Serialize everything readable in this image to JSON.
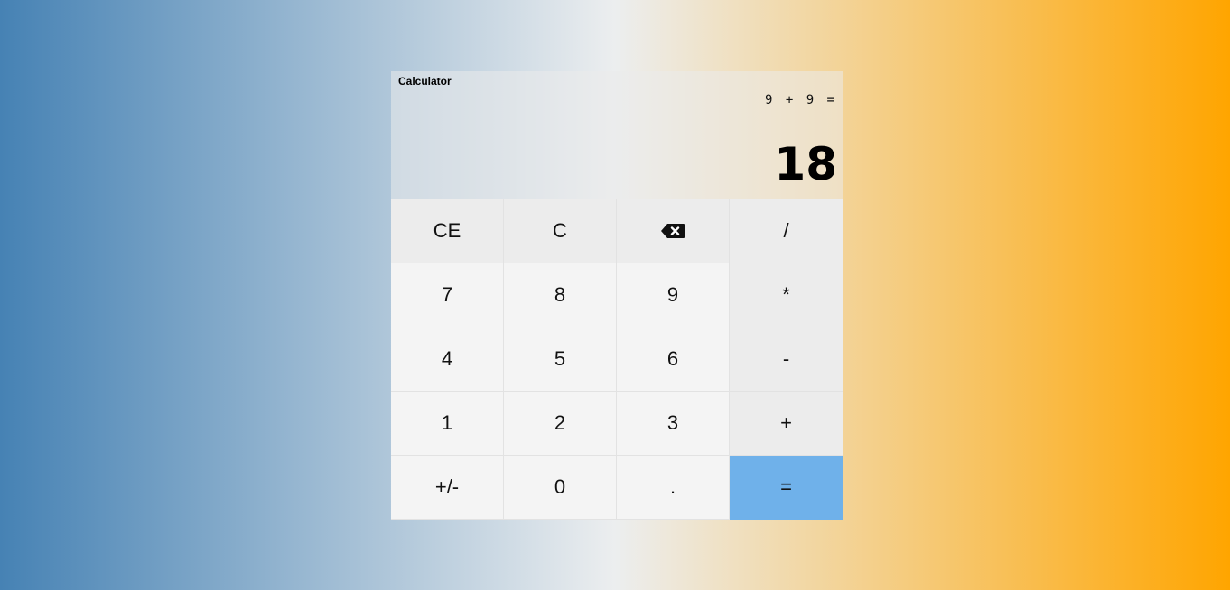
{
  "app": {
    "title": "Calculator"
  },
  "display": {
    "expression": "9 + 9 =",
    "result": "18"
  },
  "keys": {
    "ce": "CE",
    "c": "C",
    "backspace_icon": "backspace-icon",
    "divide": "/",
    "seven": "7",
    "eight": "8",
    "nine": "9",
    "multiply": "*",
    "four": "4",
    "five": "5",
    "six": "6",
    "minus": "-",
    "one": "1",
    "two": "2",
    "three": "3",
    "plus": "+",
    "negate": "+/-",
    "zero": "0",
    "decimal": ".",
    "equals": "="
  },
  "colors": {
    "gradient_left": "#4682b4",
    "gradient_right": "#ffa500",
    "equals_key": "#6fb1ea"
  }
}
